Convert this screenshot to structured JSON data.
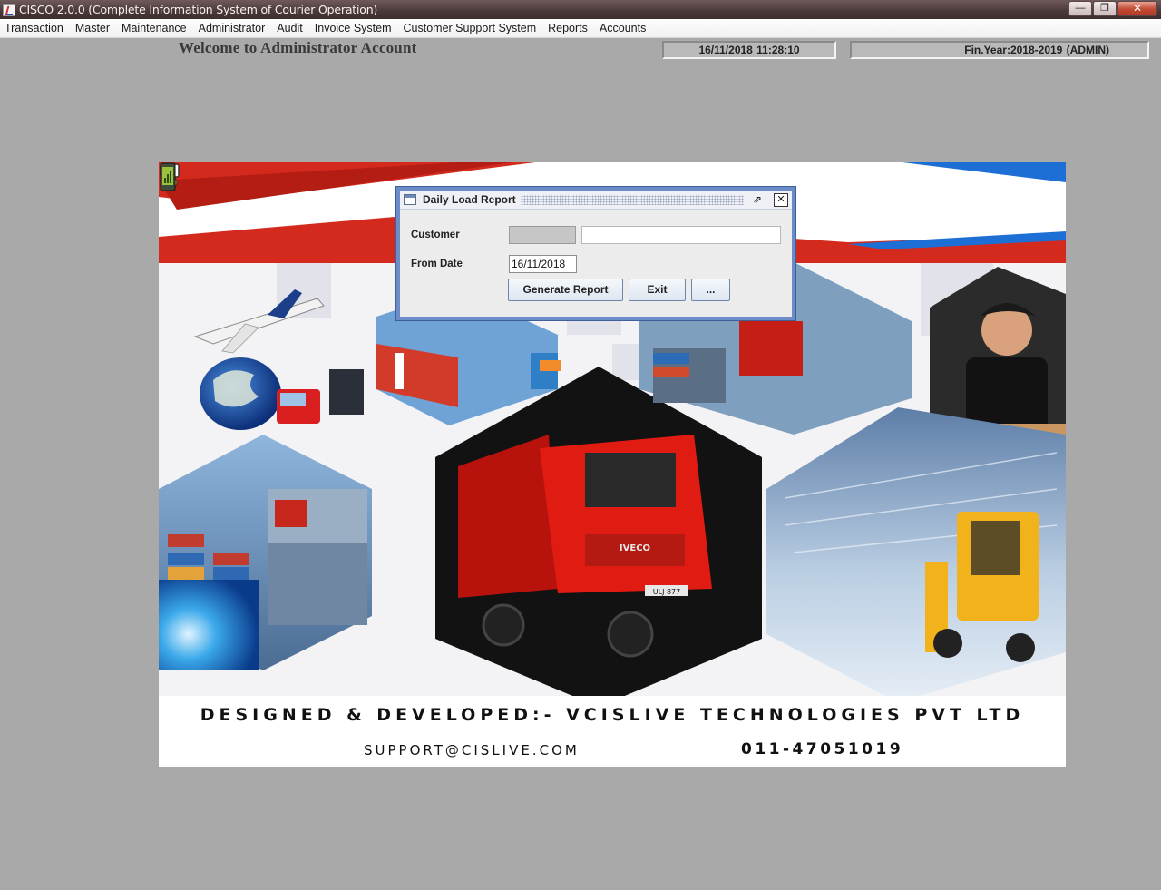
{
  "window": {
    "title": "CISCO 2.0.0 (Complete Information System of Courier Operation)",
    "minimize_icon": "minimize-icon",
    "restore_icon": "restore-icon",
    "close_icon": "close-icon"
  },
  "menu": {
    "items": [
      "Transaction",
      "Master",
      "Maintenance",
      "Administrator",
      "Audit",
      "Invoice System",
      "Customer Support System",
      "Reports",
      "Accounts"
    ]
  },
  "header": {
    "welcome": "Welcome to Administrator Account",
    "datetime": "16/11/2018     11:28:10",
    "fin_year": "Fin.Year:2018-2019  (ADMIN)"
  },
  "picture": {
    "developed_by": "DESIGNED & DEVELOPED:- VCISLIVE TECHNOLOGIES PVT LTD",
    "email": "SUPPORT@CISLIVE.COM",
    "phone": "011-47051019",
    "truck_badge": "IVECO",
    "plate": "ULJ 877"
  },
  "dialog": {
    "title": "Daily Load Report",
    "customer_label": "Customer",
    "customer_code": "",
    "customer_name": "",
    "from_date_label": "From Date",
    "from_date": "16/11/2018",
    "generate_label": "Generate Report",
    "exit_label": "Exit",
    "more_label": "..."
  },
  "colors": {
    "titlebar": "#4a3838",
    "desktop": "#a9a9a9",
    "dialog_border": "#6b8cc6",
    "banner_red": "#d42a1e",
    "banner_blue": "#1d6fd6"
  }
}
